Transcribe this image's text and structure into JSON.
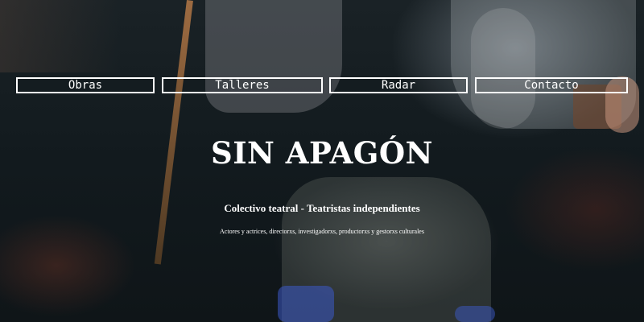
{
  "nav": {
    "items": [
      {
        "label": "Obras"
      },
      {
        "label": "Talleres"
      },
      {
        "label": "Radar"
      },
      {
        "label": "Contacto"
      }
    ]
  },
  "hero": {
    "title": "SIN APAGÓN",
    "subtitle": "Colectivo teatral - Teatristas independientes",
    "tagline": "Actores y actrices, directorxs, investigadorxs, productorxs y gestorxs culturales"
  },
  "colors": {
    "text": "#ffffff",
    "nav_border": "#ffffff",
    "background_dark": "#141a1d"
  }
}
